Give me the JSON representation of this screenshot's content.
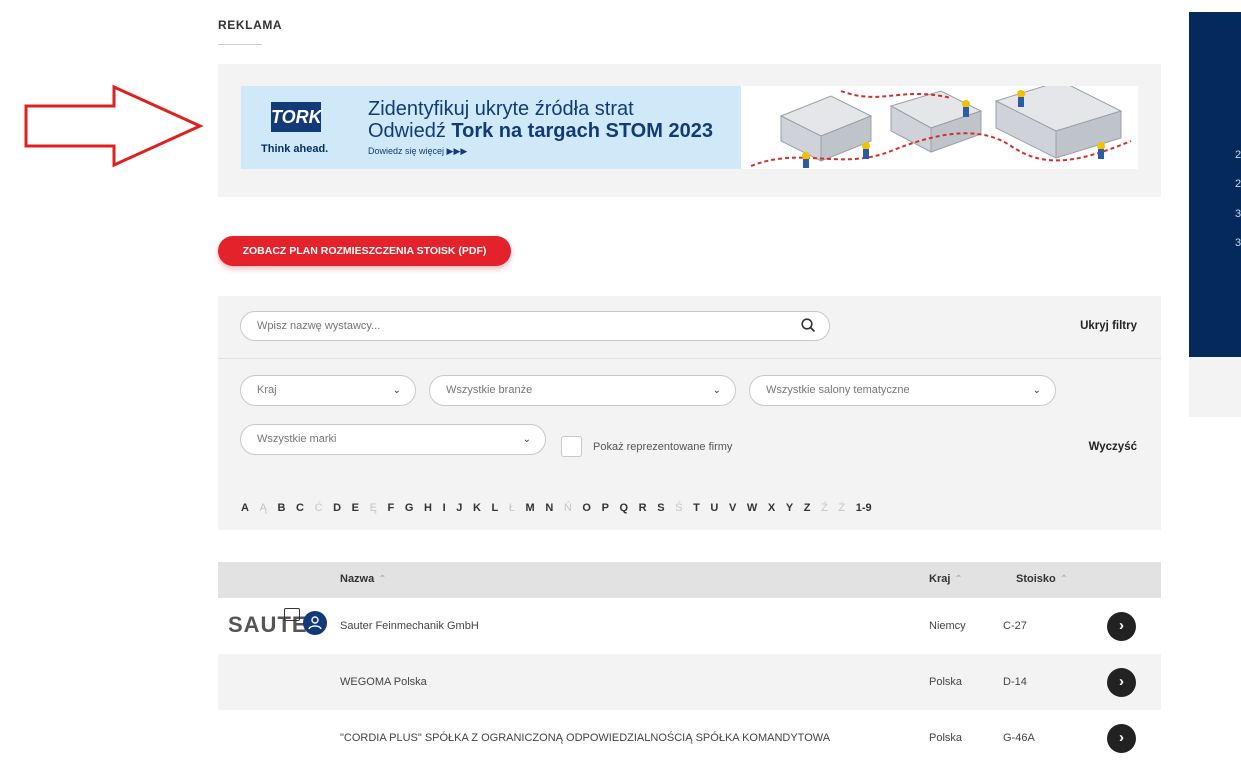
{
  "section_title": "REKLAMA",
  "ad": {
    "logo_text": "TORK",
    "tagline": "Think ahead.",
    "line1": "Zidentyfikuj ukryte źródła strat",
    "line2_prefix": "Odwiedź ",
    "line2_bold": "Tork na targach STOM 2023",
    "cta": "Dowiedz się więcej ▶▶▶"
  },
  "plan_button": "ZOBACZ PLAN ROZMIESZCZENIA STOISK (PDF)",
  "filters": {
    "search_placeholder": "Wpisz nazwę wystawcy...",
    "hide_filters": "Ukryj filtry",
    "country": "Kraj",
    "industries": "Wszystkie branże",
    "salons": "Wszystkie salony tematyczne",
    "brands": "Wszystkie marki",
    "show_represented": "Pokaż reprezentowane firmy",
    "clear": "Wyczyść"
  },
  "alphabet": [
    {
      "l": "A",
      "active": true
    },
    {
      "l": "Ą",
      "active": false
    },
    {
      "l": "B",
      "active": true
    },
    {
      "l": "C",
      "active": true
    },
    {
      "l": "Ć",
      "active": false
    },
    {
      "l": "D",
      "active": true
    },
    {
      "l": "E",
      "active": true
    },
    {
      "l": "Ę",
      "active": false
    },
    {
      "l": "F",
      "active": true
    },
    {
      "l": "G",
      "active": true
    },
    {
      "l": "H",
      "active": true
    },
    {
      "l": "I",
      "active": true
    },
    {
      "l": "J",
      "active": true
    },
    {
      "l": "K",
      "active": true
    },
    {
      "l": "L",
      "active": true
    },
    {
      "l": "Ł",
      "active": false
    },
    {
      "l": "M",
      "active": true
    },
    {
      "l": "N",
      "active": true
    },
    {
      "l": "Ń",
      "active": false
    },
    {
      "l": "O",
      "active": true
    },
    {
      "l": "P",
      "active": true
    },
    {
      "l": "Q",
      "active": true
    },
    {
      "l": "R",
      "active": true
    },
    {
      "l": "S",
      "active": true
    },
    {
      "l": "Ś",
      "active": false
    },
    {
      "l": "T",
      "active": true
    },
    {
      "l": "U",
      "active": true
    },
    {
      "l": "V",
      "active": true
    },
    {
      "l": "W",
      "active": true
    },
    {
      "l": "X",
      "active": true
    },
    {
      "l": "Y",
      "active": true
    },
    {
      "l": "Z",
      "active": true
    },
    {
      "l": "Ź",
      "active": false
    },
    {
      "l": "Ż",
      "active": false
    },
    {
      "l": "1-9",
      "active": true
    }
  ],
  "table": {
    "headers": {
      "name": "Nazwa",
      "country": "Kraj",
      "stand": "Stoisko"
    },
    "rows": [
      {
        "logo": "SAUTER",
        "name": "Sauter Feinmechanik GmbH",
        "country": "Niemcy",
        "stand": "C-27"
      },
      {
        "logo": "",
        "name": "WEGOMA Polska",
        "country": "Polska",
        "stand": "D-14"
      },
      {
        "logo": "",
        "name": "\"CORDIA PLUS\" SPÓŁKA Z OGRANICZONĄ ODPOWIEDZIALNOŚCIĄ SPÓŁKA KOMANDYTOWA",
        "country": "Polska",
        "stand": "G-46A"
      }
    ]
  },
  "right_panel": {
    "numbers": [
      "2",
      "2",
      "3",
      "3"
    ]
  },
  "colors": {
    "accent_red": "#e3222b",
    "navy": "#032a5a",
    "tork_blue": "#123a78",
    "annotation_red": "#e02020"
  }
}
